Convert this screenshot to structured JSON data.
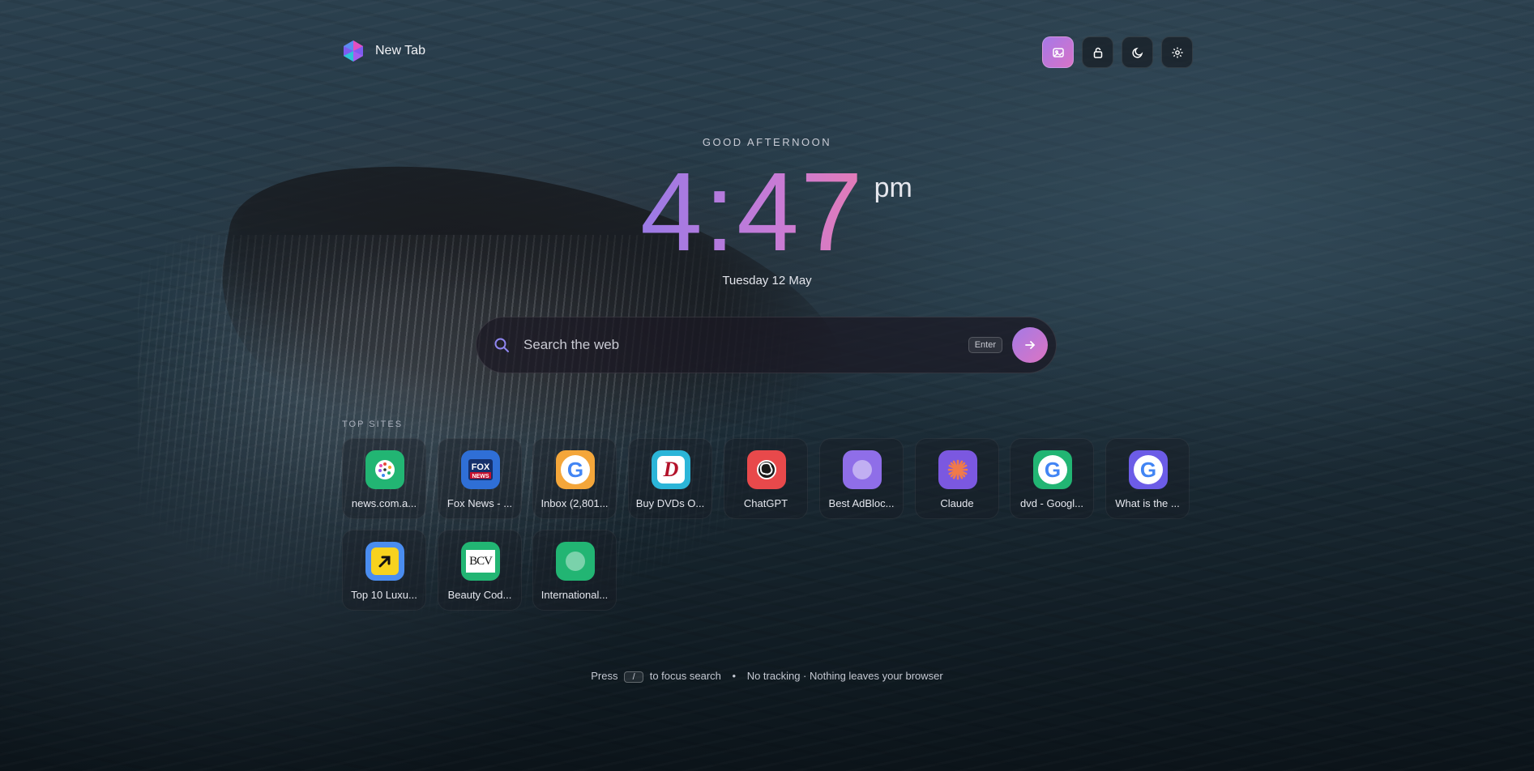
{
  "header": {
    "title": "New Tab",
    "buttons": [
      {
        "icon": "image-icon",
        "name": "wallpaper-button",
        "active": true
      },
      {
        "icon": "lock-icon",
        "name": "lock-button",
        "active": false
      },
      {
        "icon": "moon-icon",
        "name": "theme-button",
        "active": false
      },
      {
        "icon": "gear-icon",
        "name": "settings-button",
        "active": false
      }
    ]
  },
  "hero": {
    "greeting": "GOOD AFTERNOON",
    "time": "4:47",
    "ampm": "pm",
    "date": "Tuesday 12 May"
  },
  "search": {
    "placeholder": "Search the web",
    "enter_hint": "Enter"
  },
  "top_sites": {
    "label": "TOP SITES",
    "items": [
      {
        "label": "news.com.a...",
        "icon": "news-dots-icon",
        "color": "#22b573"
      },
      {
        "label": "Fox News - ...",
        "icon": "fox-news-icon",
        "color": "#2f6fd6"
      },
      {
        "label": "Inbox (2,801...",
        "icon": "google-g-icon",
        "color": "#f4a63a"
      },
      {
        "label": "Buy DVDs O...",
        "icon": "dvd-d-icon",
        "color": "#2bb5d8"
      },
      {
        "label": "ChatGPT",
        "icon": "openai-icon",
        "color": "#e8494b"
      },
      {
        "label": "Best AdBloc...",
        "icon": "globe-placeholder-icon",
        "color": "#8f6ee8"
      },
      {
        "label": "Claude",
        "icon": "claude-asterisk-icon",
        "color": "#7b58e0"
      },
      {
        "label": "dvd - Googl...",
        "icon": "google-g-icon",
        "color": "#22b573"
      },
      {
        "label": "What is the ...",
        "icon": "google-g-icon",
        "color": "#6c5ce7"
      },
      {
        "label": "Top 10 Luxu...",
        "icon": "arrow-up-right-icon",
        "color": "#4a8df0"
      },
      {
        "label": "Beauty Cod...",
        "icon": "bcv-icon",
        "color": "#22b573"
      },
      {
        "label": "International...",
        "icon": "globe-placeholder-icon",
        "color": "#22b573"
      }
    ]
  },
  "footer": {
    "press": "Press",
    "key": "/",
    "focus_text": "to focus search",
    "separator": "•",
    "privacy": "No tracking · Nothing leaves your browser"
  }
}
